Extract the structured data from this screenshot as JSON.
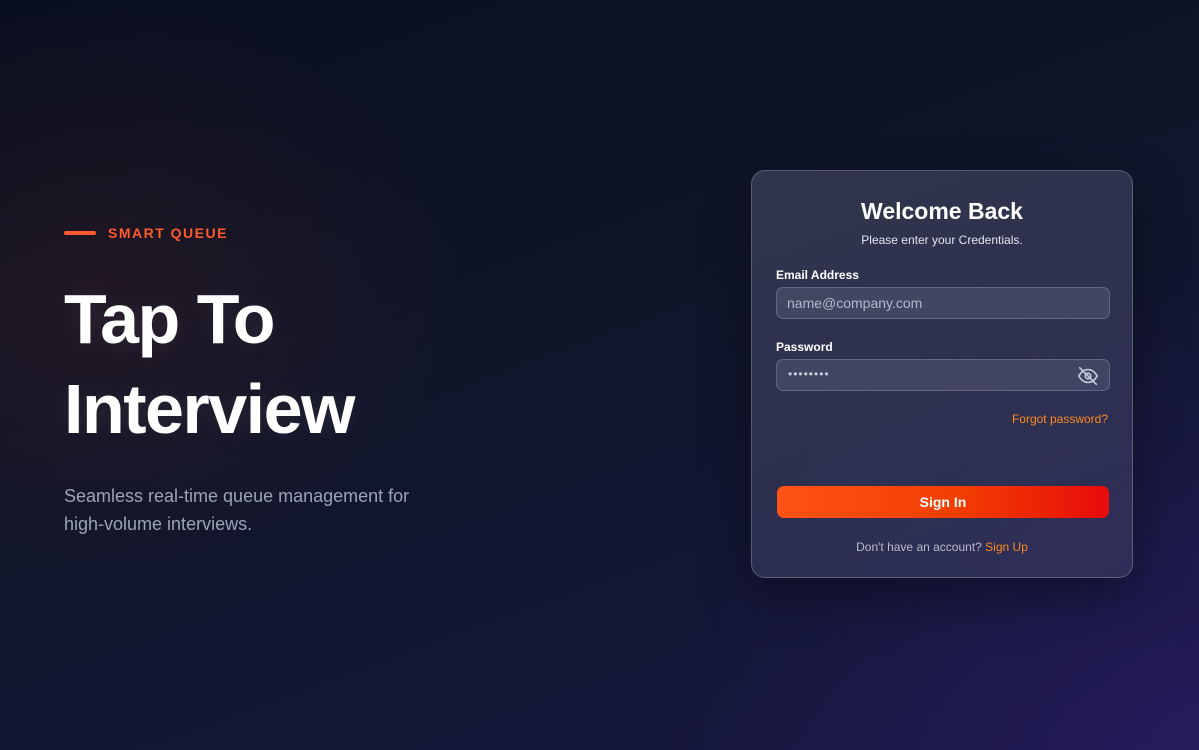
{
  "hero": {
    "eyebrow": "SMART QUEUE",
    "title_line1": "Tap To",
    "title_line2": "Interview",
    "subtitle": "Seamless real-time queue management for high-volume interviews."
  },
  "login": {
    "title": "Welcome Back",
    "subtitle": "Please enter your Credentials.",
    "email": {
      "label": "Email Address",
      "placeholder": "name@company.com",
      "value": ""
    },
    "password": {
      "label": "Password",
      "masked_value": "••••••••",
      "toggle_icon": "eye-off-icon"
    },
    "forgot_password": "Forgot password?",
    "submit": "Sign In",
    "signup_prompt": "Don't have an account?",
    "signup_link": "Sign Up"
  },
  "colors": {
    "accent": "#ff5a2c",
    "link": "#ff8a1f",
    "button_start": "#ff5316",
    "button_end": "#e80c0c",
    "background": "#0f1528"
  }
}
